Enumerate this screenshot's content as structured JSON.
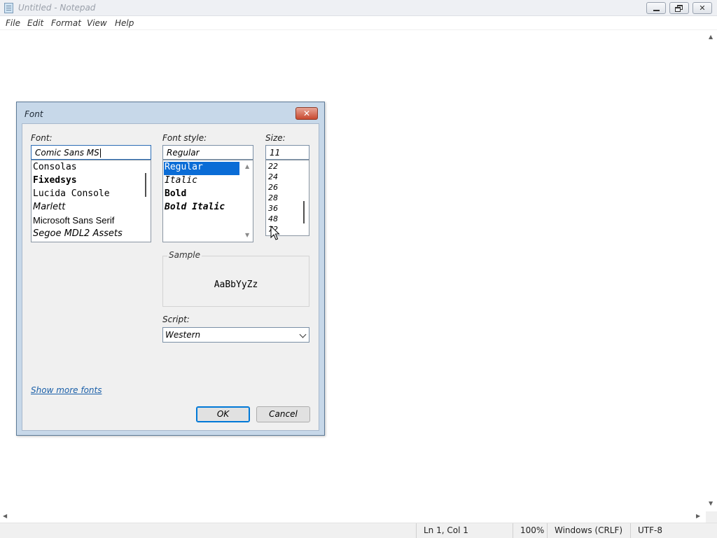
{
  "window": {
    "title": "Untitled - Notepad",
    "menu": [
      "File",
      "Edit",
      "Format",
      "View",
      "Help"
    ],
    "controls": {
      "minimize": "minimize",
      "restore": "restore",
      "close": "✕"
    }
  },
  "status_bar": {
    "position": "Ln 1, Col 1",
    "zoom": "100%",
    "line_ending": "Windows (CRLF)",
    "encoding": "UTF-8"
  },
  "font_dialog": {
    "title": "Font",
    "close_glyph": "✕",
    "font_label": "Font:",
    "font_value": "Comic Sans MS",
    "fonts": [
      {
        "label": "Consolas",
        "style": "mono"
      },
      {
        "label": "Fixedsys",
        "style": "mono-bold"
      },
      {
        "label": "Lucida Console",
        "style": "mono"
      },
      {
        "label": "Marlett",
        "style": "serif-it"
      },
      {
        "label": "Microsoft Sans Serif",
        "style": "sans"
      },
      {
        "label": "Segoe MDL2 Assets",
        "style": "serif-it"
      }
    ],
    "style_label": "Font style:",
    "style_value": "Regular",
    "styles": [
      "Regular",
      "Italic",
      "Bold",
      "Bold Italic"
    ],
    "selected_style": "Regular",
    "size_label": "Size:",
    "size_value": "11",
    "sizes": [
      "22",
      "24",
      "26",
      "28",
      "36",
      "48",
      "72"
    ],
    "sample_label": "Sample",
    "sample_text": "AaBbYyZz",
    "script_label": "Script:",
    "script_value": "Western",
    "show_more_fonts": "Show more fonts",
    "ok": "OK",
    "cancel": "Cancel"
  },
  "colors": {
    "selection": "#0a6cd6",
    "dialog_frame": "#c7d8e9",
    "link": "#1a5fa8",
    "close_button": "#c8492f"
  }
}
